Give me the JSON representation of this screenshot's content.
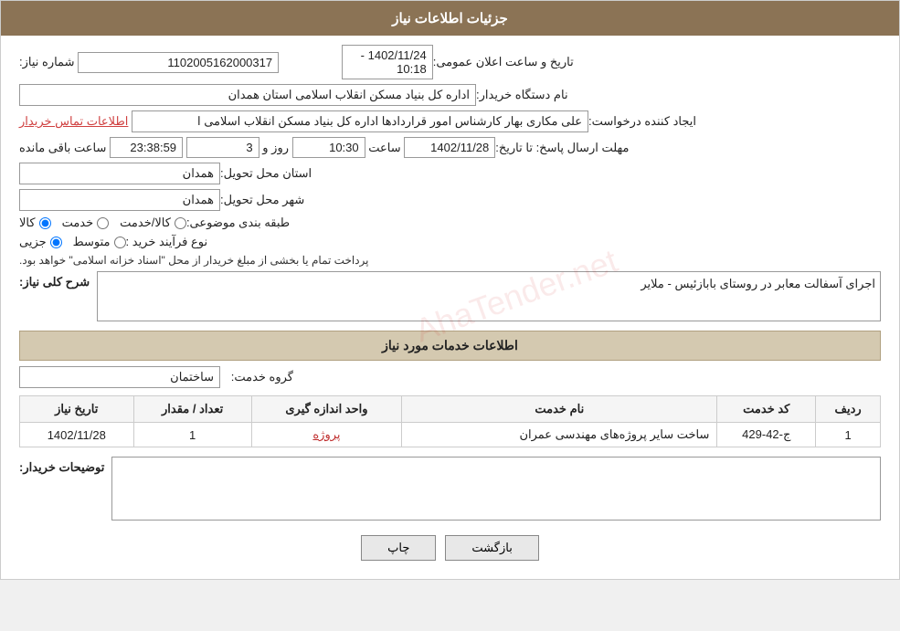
{
  "header": {
    "title": "جزئیات اطلاعات نیاز"
  },
  "fields": {
    "shomara_niaz_label": "شماره نیاز:",
    "shomara_niaz_value": "1102005162000317",
    "nam_dastgah_label": "نام دستگاه خریدار:",
    "nam_dastgah_value": "اداره کل بنیاد مسکن انقلاب اسلامی استان همدان",
    "ijad_konande_label": "ایجاد کننده درخواست:",
    "ijad_konande_value": "علی مکاری بهار کارشناس امور قراردادها اداره کل بنیاد مسکن انقلاب اسلامی ا",
    "contact_link": "اطلاعات تماس خریدار",
    "mohlat_label": "مهلت ارسال پاسخ: تا تاریخ:",
    "mohlat_date": "1402/11/28",
    "mohlat_saat_label": "ساعت",
    "mohlat_saat": "10:30",
    "mohlat_rooz_label": "روز و",
    "mohlat_rooz": "3",
    "mohlat_countdown": "23:38:59",
    "mohlat_baqi": "ساعت باقی مانده",
    "ostan_label": "استان محل تحویل:",
    "ostan_value": "همدان",
    "shahr_label": "شهر محل تحویل:",
    "shahr_value": "همدان",
    "tabaqe_label": "طبقه بندی موضوعی:",
    "radio_kala": "کالا",
    "radio_khedmat": "خدمت",
    "radio_kala_khedmat": "کالا/خدمت",
    "now_farayand_label": "نوع فرآیند خرید :",
    "radio_jozi": "جزیی",
    "radio_motavaset": "متوسط",
    "purchase_note": "پرداخت تمام یا بخشی از مبلغ خریدار از محل \"اسناد خزانه اسلامی\" خواهد بود.",
    "tarikh_ialan_label": "تاریخ و ساعت اعلان عمومی:",
    "tarikh_ialan_value": "1402/11/24 - 10:18",
    "sharh_label": "شرح کلی نیاز:",
    "sharh_value": "اجرای آسفالت معابر در روستای بابازئیس - ملایر",
    "khadamat_section": "اطلاعات خدمات مورد نیاز",
    "gorohe_khedmat_label": "گروه خدمت:",
    "gorohe_khedmat_value": "ساختمان",
    "table": {
      "headers": [
        "ردیف",
        "کد خدمت",
        "نام خدمت",
        "واحد اندازه گیری",
        "تعداد / مقدار",
        "تاریخ نیاز"
      ],
      "rows": [
        {
          "radif": "1",
          "kod": "ج-42-429",
          "nam": "ساخت سایر پروژه‌های مهندسی عمران",
          "vahed": "پروژه",
          "tedad": "1",
          "tarikh": "1402/11/28"
        }
      ]
    },
    "tozihat_label": "توضیحات خریدار:",
    "tozihat_value": ""
  },
  "buttons": {
    "print": "چاپ",
    "back": "بازگشت"
  }
}
